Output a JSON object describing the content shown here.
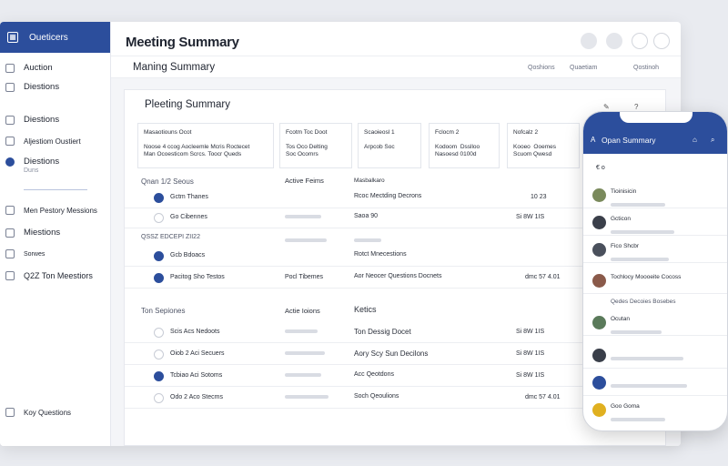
{
  "sidebar": {
    "brand": "Oueticers",
    "items": [
      {
        "label": "Auction"
      },
      {
        "label": "Diestions"
      },
      {
        "label": "Diestions"
      },
      {
        "label": "Aljestiom Oustiert"
      },
      {
        "label": "Diestions",
        "sub": "Duns"
      },
      {
        "label": "Men Pestory Messions"
      },
      {
        "label": "Miestions"
      },
      {
        "label": "Sorwes"
      },
      {
        "label": "Q2Z Ton Meestiors"
      },
      {
        "label": "Koy Questions"
      }
    ]
  },
  "header": {
    "title": "Meeting Summary",
    "subtitle": "Maning Summary",
    "actions": [
      "Qoshions",
      "Quaetiam",
      "Qostinoh"
    ]
  },
  "panel": {
    "title": "Pleeting Summary",
    "cards": [
      {
        "head": "Masaotiouns Ocot",
        "body": "Noose 4 ccog Aocleemle Mcris Roctecet\nMan Ocoesticom Scrcs. Toocr Queds"
      },
      {
        "head": "Fcotm Toc   Doot",
        "body": "Tos Oco Delting\nSoc Ocomrs"
      },
      {
        "head": "Scaoieosl 1",
        "body": "Arpcob Soc"
      },
      {
        "head": "Fclocm 2",
        "body": "Kodoom  Dsslloo\nNasoesd 0100d"
      },
      {
        "head": "Nofcalz 2",
        "body": "Kooeo  Ooemes\nScuom Qwesd"
      }
    ]
  },
  "section1": {
    "head": "Qnan 1/2 Seous",
    "col2": "Active Feims",
    "col3": "Masbalkaro",
    "rows": [
      {
        "c1": "Gctm Thanes",
        "c2": "",
        "c3": "Rcoc Mectding Decrons",
        "c4": "10 23"
      },
      {
        "c1": "Go Cibennes",
        "c2": "",
        "c3": "Saoa 90",
        "c4": "Si 8W 1IS"
      }
    ]
  },
  "section2": {
    "head": "QSSZ EDCEPI ZII22",
    "rows": [
      {
        "c1": "Gcb Bdoacs",
        "c2": "",
        "c3": "Rotct Mnecestions",
        "c4": ""
      },
      {
        "c1": "Pacitog Sho Testos",
        "c2": "Pocl Tibemes",
        "c3": "Aor Neocer Questions Docnets",
        "c4": "dmc 57 4.01"
      }
    ]
  },
  "section3": {
    "head": "Ton Sepiones",
    "col2": "Actie Ioions",
    "col3": "Ketics",
    "rows": [
      {
        "c1": "Scis  Acs Nedoots",
        "c2": "",
        "c3": "Ton Dessig Docet",
        "c4": "Si 8W 1IS"
      },
      {
        "c1": "Oiob 2  Aci Secuers",
        "c2": "",
        "c3": "Aory Scy Sun Decilons",
        "c4": "Si 8W 1IS"
      },
      {
        "c1": "Tcbiao  Aci Sotoms",
        "c2": "",
        "c3": "Acc Qeotdons",
        "c4": "Si 8W 1IS"
      },
      {
        "c1": "Odo 2  Aco Stecms",
        "c2": "",
        "c3": "Soch Qeoulions",
        "c4": "dmc 57 4.01"
      }
    ]
  },
  "phone": {
    "title": "Opan Summary",
    "sub": "€ o",
    "rows": [
      {
        "t": "Tioinisicin",
        "color": "#7a8a5c"
      },
      {
        "t": "Gcticon",
        "color": "#3a3f4a"
      },
      {
        "t": "Fico Shcbr",
        "color": "#4a505c"
      },
      {
        "t": "Tochlocy Moooeite Cocoss",
        "color": "#8a5a4a"
      },
      {
        "t": "Ocutan",
        "color": "#5a7a5a"
      },
      {
        "t": "",
        "color": "#3a3f4a"
      },
      {
        "t": "",
        "color": "#2c4e9c"
      },
      {
        "t": "Goo Goma",
        "color": "#e0b020"
      }
    ],
    "chips": "Qedes   Decoies   Bosebes"
  }
}
